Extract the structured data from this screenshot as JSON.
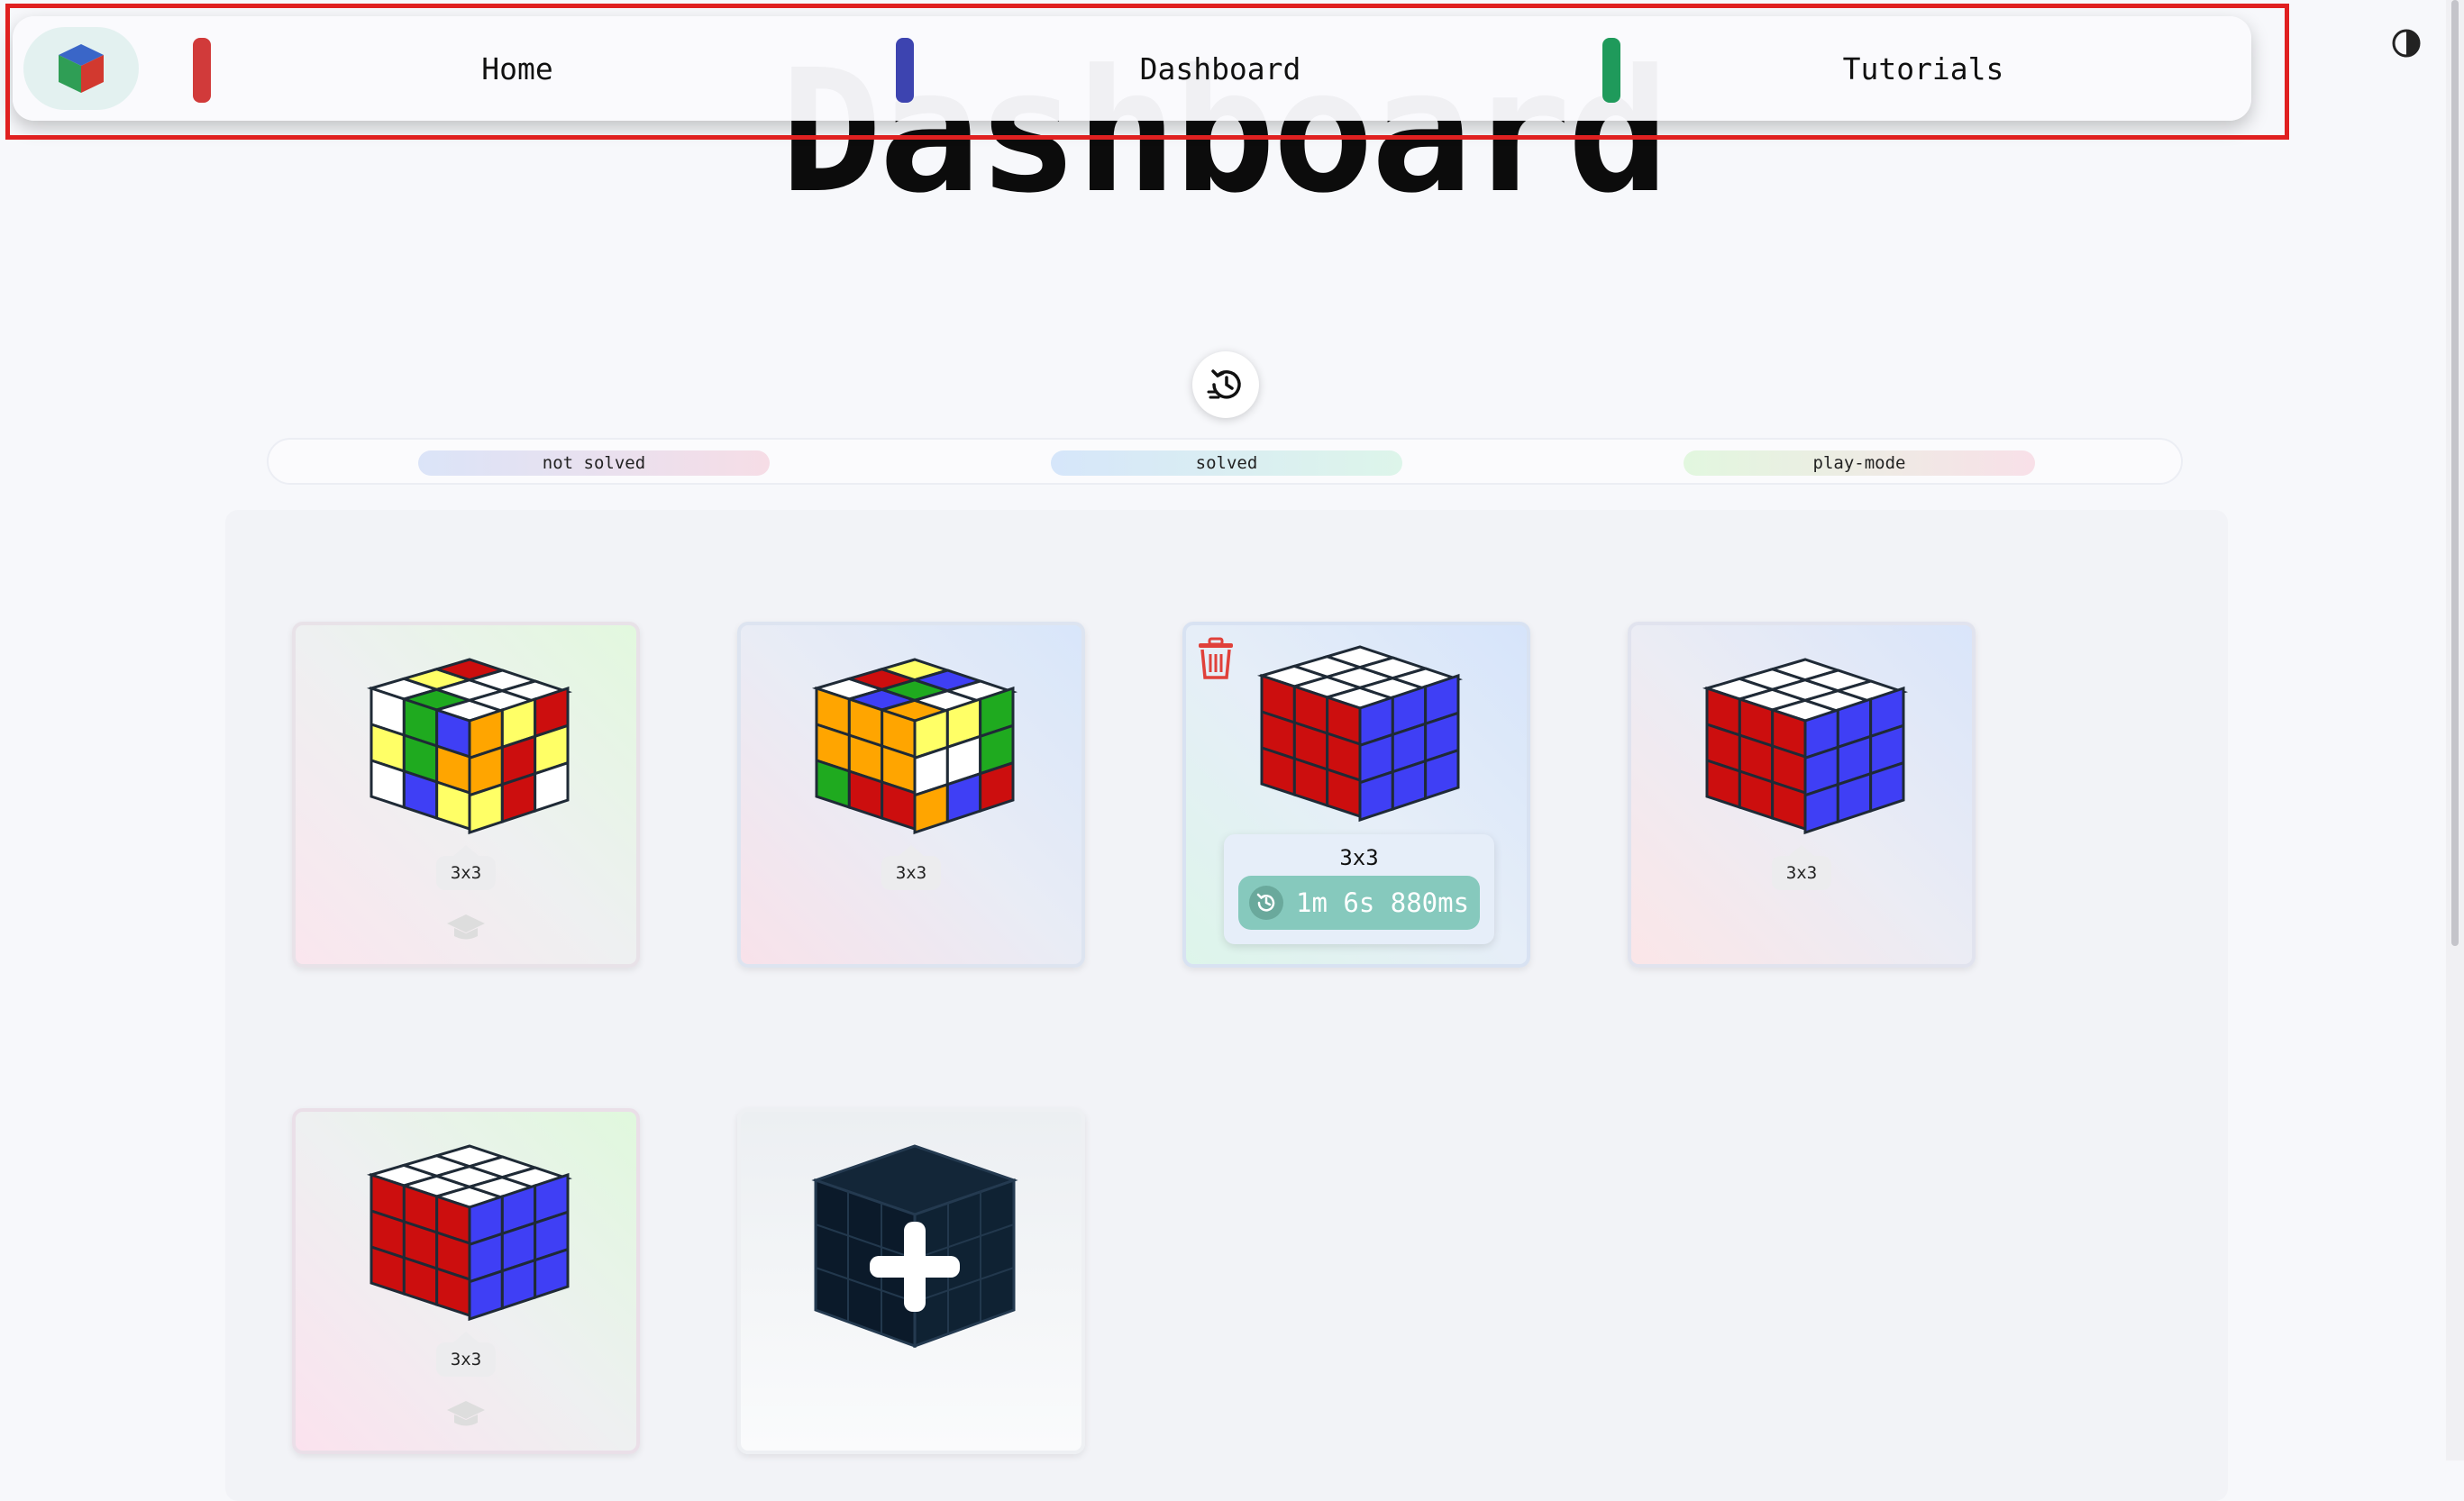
{
  "nav": {
    "links": [
      {
        "label": "Home",
        "marker_color": "#d13a3a"
      },
      {
        "label": "Dashboard",
        "marker_color": "#3d44b0"
      },
      {
        "label": "Tutorials",
        "marker_color": "#1f9a5b"
      }
    ]
  },
  "page": {
    "title": "Dashboard"
  },
  "filters": [
    "not solved",
    "solved",
    "play-mode"
  ],
  "cards": [
    {
      "size": "3x3",
      "state": "not solved",
      "has_tutorial_icon": true
    },
    {
      "size": "3x3",
      "state": "not solved",
      "has_tutorial_icon": false
    },
    {
      "size": "3x3",
      "state": "solved",
      "solve_time": "1m 6s 880ms",
      "has_delete_icon": true
    },
    {
      "size": "3x3",
      "state": "solved",
      "has_tutorial_icon": false
    },
    {
      "size": "3x3",
      "state": "solved",
      "has_tutorial_icon": true
    }
  ],
  "add_card": {
    "icon": "plus-cube-icon"
  },
  "colors": {
    "accent_red": "#e02020",
    "time_pill": "#86c9bd",
    "delete_icon": "#e0403a"
  },
  "icons": [
    "cube-logo-icon",
    "contrast-icon",
    "history-icon",
    "trash-icon",
    "clock-icon",
    "graduation-cap-icon",
    "plus-cube-icon"
  ]
}
